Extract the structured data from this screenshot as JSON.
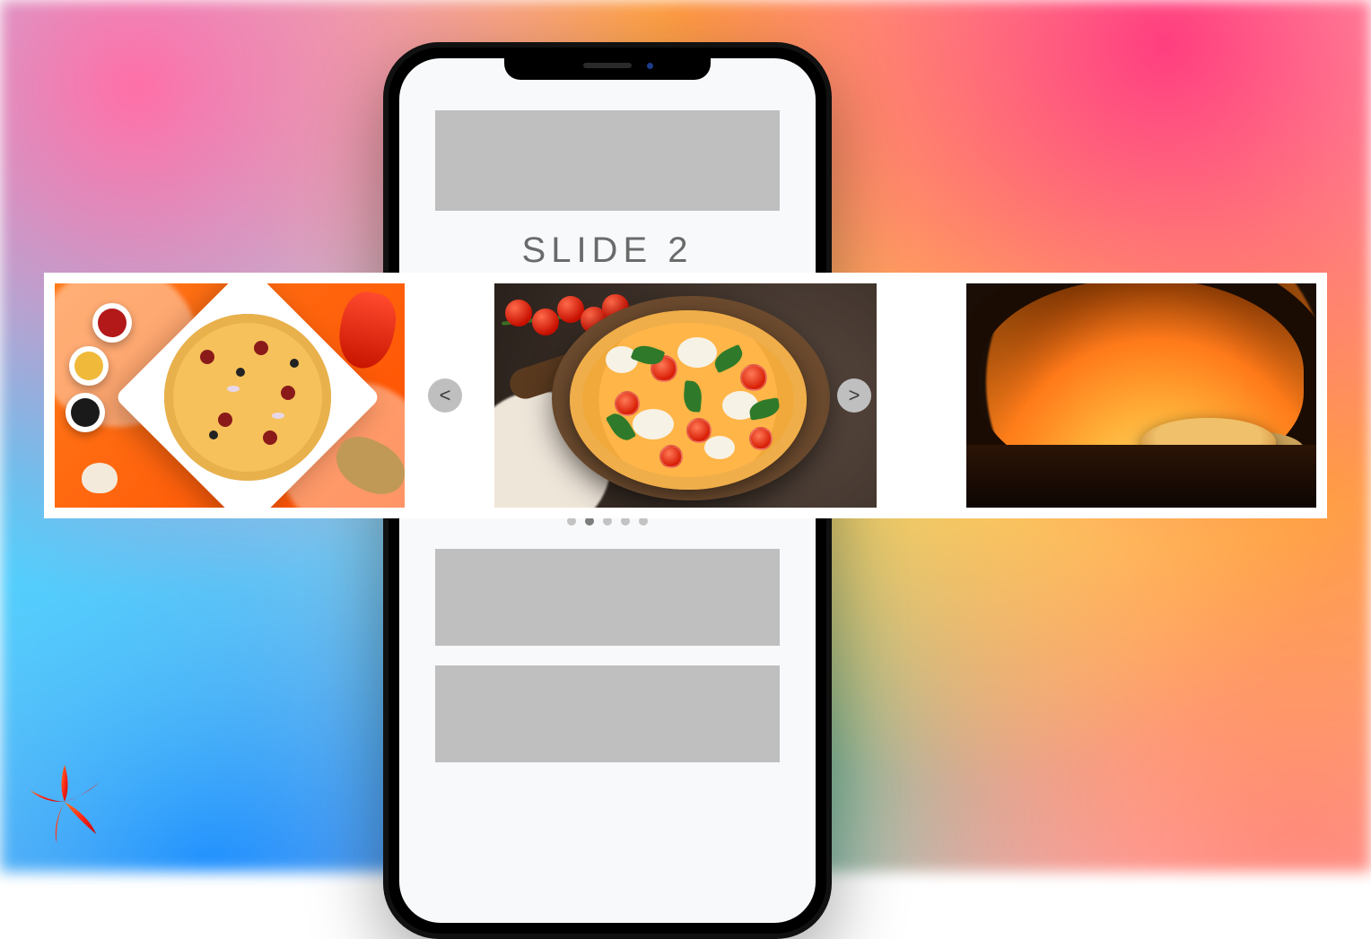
{
  "slider": {
    "title": "SLIDE 2",
    "prev_glyph": "<",
    "next_glyph": ">",
    "active_index": 1,
    "dot_count": 5,
    "slides": [
      {
        "name": "slide-1",
        "alt": "Flat-lay loaded pizza on white plate, orange background with sauce bowls, pepper, ginger, garlic"
      },
      {
        "name": "slide-2",
        "alt": "Margherita pizza with mozzarella, cherry tomatoes and basil on round wooden board, dark surface, vine tomatoes behind"
      },
      {
        "name": "slide-3",
        "alt": "Pizza on a peel inside a glowing wood-fired brick oven"
      }
    ]
  }
}
